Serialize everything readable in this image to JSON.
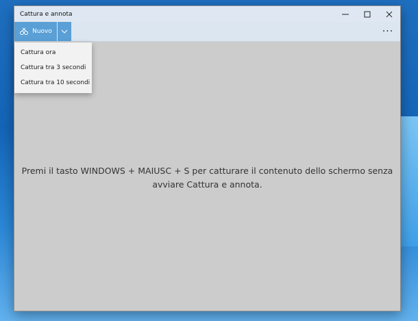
{
  "window": {
    "title": "Cattura e annota",
    "controls": {
      "minimize": "—",
      "maximize": "☐",
      "close": "✕"
    }
  },
  "toolbar": {
    "new_label": "Nuovo",
    "new_icon": "snip-icon",
    "dropdown_icon": "chevron-down-icon",
    "more_label": "···"
  },
  "menu": {
    "items": [
      {
        "label": "Cattura ora"
      },
      {
        "label": "Cattura tra 3 secondi"
      },
      {
        "label": "Cattura tra 10 secondi"
      }
    ]
  },
  "content": {
    "hint_line1": "Premi il tasto WINDOWS + MAIUSC + S per catturare il contenuto dello schermo senza",
    "hint_line2": "avviare Cattura e annota."
  },
  "colors": {
    "accent": "#5a9fd6",
    "canvas": "#cccccc",
    "titlebar": "#dfe8f2"
  }
}
